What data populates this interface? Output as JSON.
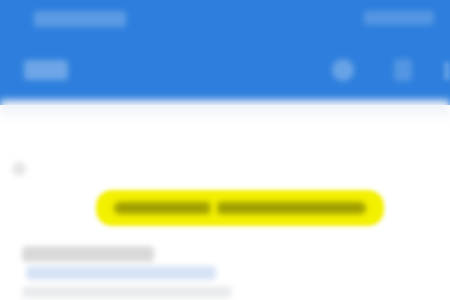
{
  "colors": {
    "app_bar": "#2e7fdd",
    "highlight": "#f3f000",
    "background": "#ffffff"
  },
  "app_bar": {
    "title": "",
    "actions": [
      {
        "icon": "search-icon"
      },
      {
        "icon": "more-icon"
      }
    ]
  },
  "content": {
    "highlight_text": "",
    "item_title": "",
    "item_subtitle": ""
  }
}
